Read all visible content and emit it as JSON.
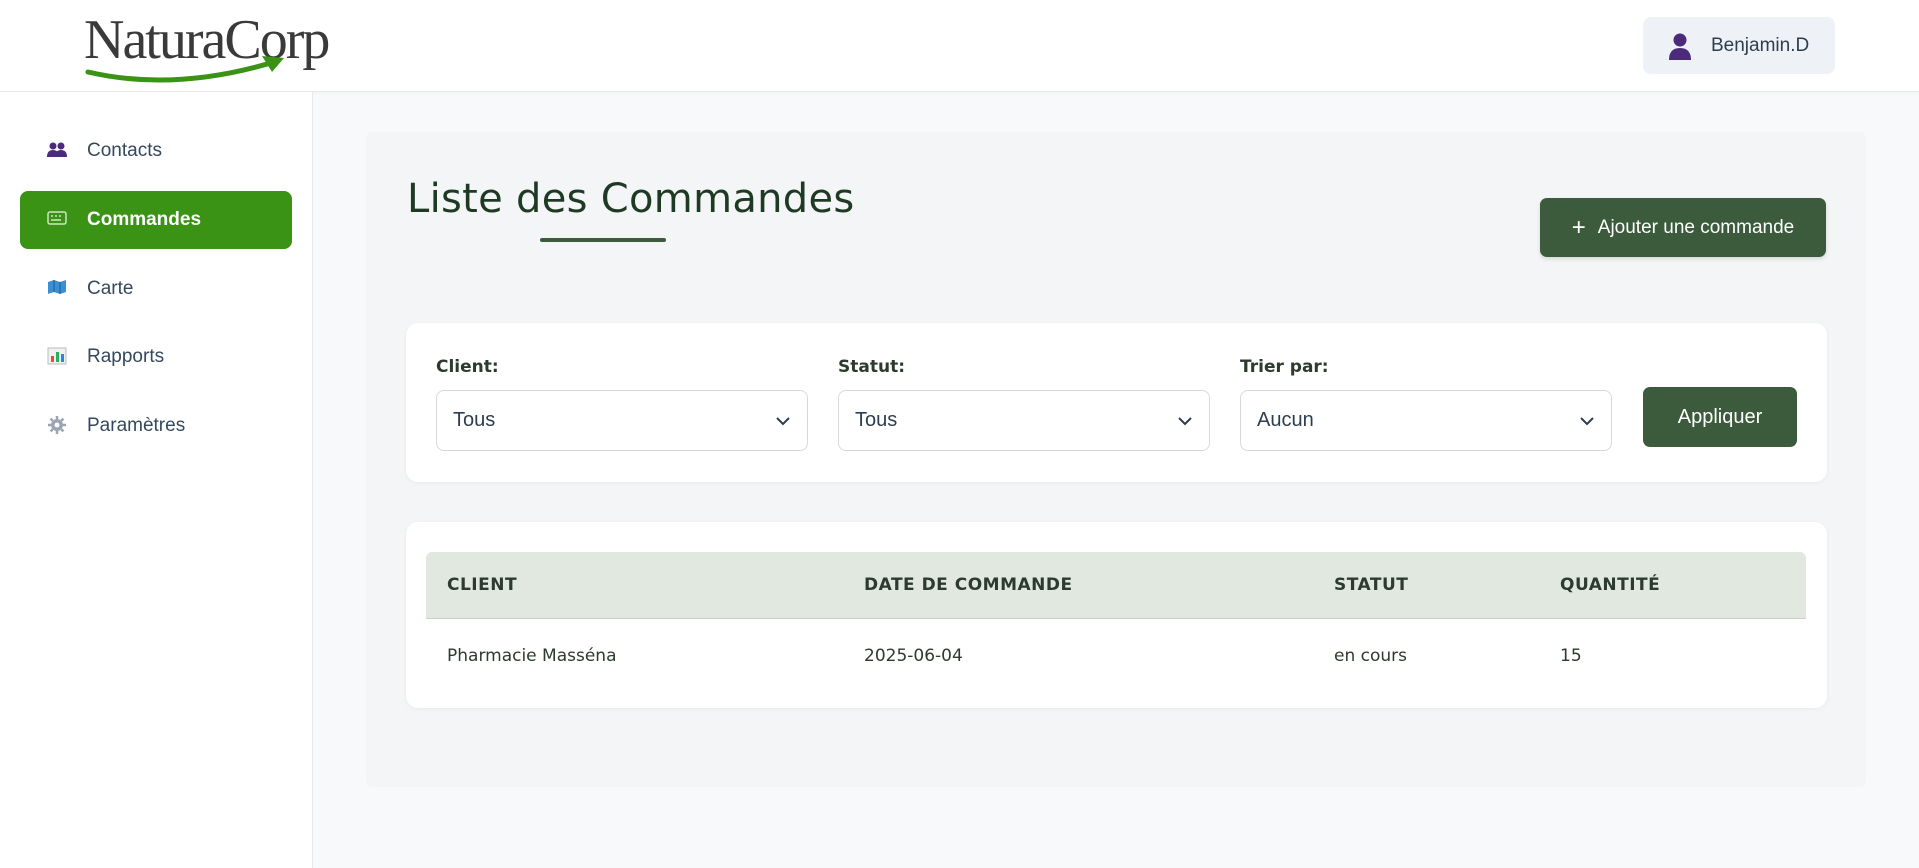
{
  "header": {
    "logo_text": "NaturaCorp",
    "user_name": "Benjamin.D"
  },
  "sidebar": {
    "items": [
      {
        "label": "Contacts",
        "icon": "people-icon"
      },
      {
        "label": "Commandes",
        "icon": "keyboard-icon",
        "active": true
      },
      {
        "label": "Carte",
        "icon": "map-icon"
      },
      {
        "label": "Rapports",
        "icon": "bar-chart-icon"
      },
      {
        "label": "Paramètres",
        "icon": "gear-icon"
      }
    ]
  },
  "main": {
    "title": "Liste des Commandes",
    "add_button_label": "Ajouter une commande",
    "add_button_icon": "plus-icon"
  },
  "filters": {
    "client_label": "Client:",
    "client_value": "Tous",
    "status_label": "Statut:",
    "status_value": "Tous",
    "sort_label": "Trier par:",
    "sort_value": "Aucun",
    "apply_label": "Appliquer"
  },
  "table": {
    "headers": [
      "CLIENT",
      "DATE DE COMMANDE",
      "STATUT",
      "QUANTITÉ"
    ],
    "rows": [
      [
        "Pharmacie Masséna",
        "2025-06-04",
        "en cours",
        "15"
      ]
    ]
  },
  "colors": {
    "accent_green": "#3a9314",
    "dark_green": "#3b5b3c",
    "table_header_bg": "#e0e8df",
    "user_icon": "#4b2a7a"
  }
}
